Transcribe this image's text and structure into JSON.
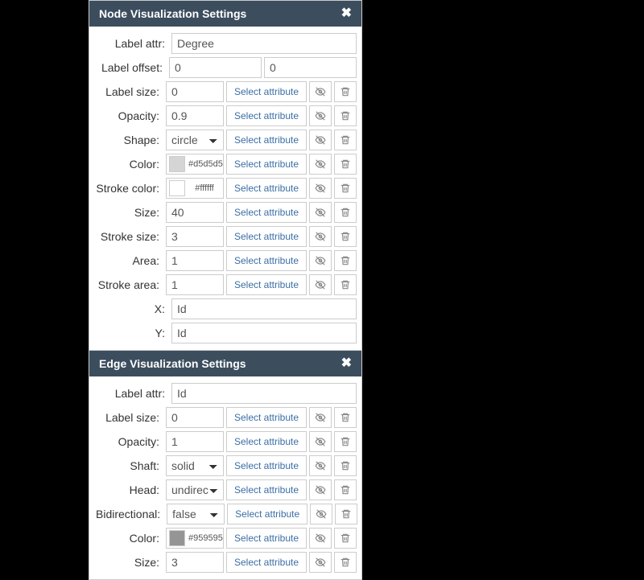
{
  "node_panel": {
    "title": "Node Visualization Settings",
    "rows": {
      "label_attr": {
        "label": "Label attr:",
        "value": "Degree"
      },
      "label_offset": {
        "label": "Label offset:",
        "x": "0",
        "y": "0"
      },
      "label_size": {
        "label": "Label size:",
        "value": "0",
        "select_btn": "Select attribute"
      },
      "opacity": {
        "label": "Opacity:",
        "value": "0.9",
        "select_btn": "Select attribute"
      },
      "shape": {
        "label": "Shape:",
        "value": "circle",
        "select_btn": "Select attribute"
      },
      "color": {
        "label": "Color:",
        "hex": "#d5d5d5",
        "select_btn": "Select attribute"
      },
      "stroke_color": {
        "label": "Stroke color:",
        "hex": "#ffffff",
        "select_btn": "Select attribute"
      },
      "size": {
        "label": "Size:",
        "value": "40",
        "select_btn": "Select attribute"
      },
      "stroke_size": {
        "label": "Stroke size:",
        "value": "3",
        "select_btn": "Select attribute"
      },
      "area": {
        "label": "Area:",
        "value": "1",
        "select_btn": "Select attribute"
      },
      "stroke_area": {
        "label": "Stroke area:",
        "value": "1",
        "select_btn": "Select attribute"
      },
      "x": {
        "label": "X:",
        "value": "Id"
      },
      "y": {
        "label": "Y:",
        "value": "Id"
      }
    }
  },
  "edge_panel": {
    "title": "Edge Visualization Settings",
    "rows": {
      "label_attr": {
        "label": "Label attr:",
        "value": "Id"
      },
      "label_size": {
        "label": "Label size:",
        "value": "0",
        "select_btn": "Select attribute"
      },
      "opacity": {
        "label": "Opacity:",
        "value": "1",
        "select_btn": "Select attribute"
      },
      "shaft": {
        "label": "Shaft:",
        "value": "solid",
        "select_btn": "Select attribute"
      },
      "head": {
        "label": "Head:",
        "value": "undirecte",
        "select_btn": "Select attribute"
      },
      "bidirectional": {
        "label": "Bidirectional:",
        "value": "false",
        "select_btn": "Select attribute"
      },
      "color": {
        "label": "Color:",
        "hex": "#959595",
        "select_btn": "Select attribute"
      },
      "size": {
        "label": "Size:",
        "value": "3",
        "select_btn": "Select attribute"
      }
    }
  }
}
